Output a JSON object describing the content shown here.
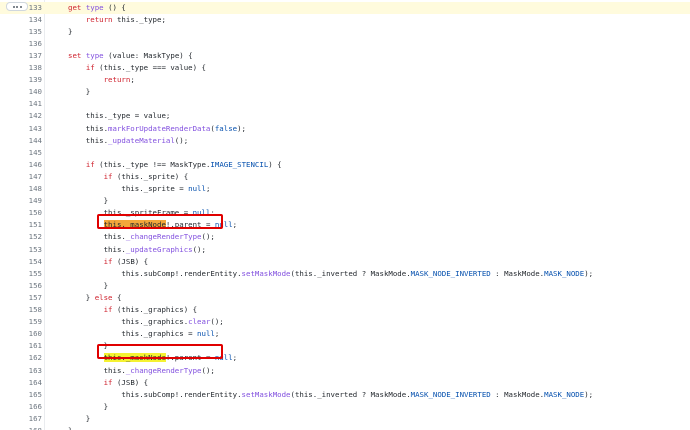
{
  "viewer": {
    "expand_label": "...",
    "lines": [
      {
        "n": "133",
        "highlight": true,
        "t": [
          {
            "c": "kw",
            "s": "get"
          },
          {
            "c": "p",
            "s": " "
          },
          {
            "c": "fn",
            "s": "type"
          },
          {
            "c": "p",
            "s": " () {"
          }
        ]
      },
      {
        "n": "134",
        "t": [
          {
            "c": "p",
            "s": "    "
          },
          {
            "c": "kw",
            "s": "return"
          },
          {
            "c": "p",
            "s": " this._type;"
          }
        ]
      },
      {
        "n": "135",
        "t": [
          {
            "c": "p",
            "s": "}"
          }
        ]
      },
      {
        "n": "136",
        "t": []
      },
      {
        "n": "137",
        "t": [
          {
            "c": "kw",
            "s": "set"
          },
          {
            "c": "p",
            "s": " "
          },
          {
            "c": "fn",
            "s": "type"
          },
          {
            "c": "p",
            "s": " (value: MaskType) {"
          }
        ]
      },
      {
        "n": "138",
        "t": [
          {
            "c": "p",
            "s": "    "
          },
          {
            "c": "kw",
            "s": "if"
          },
          {
            "c": "p",
            "s": " (this._type === value) {"
          }
        ]
      },
      {
        "n": "139",
        "t": [
          {
            "c": "p",
            "s": "        "
          },
          {
            "c": "kw",
            "s": "return"
          },
          {
            "c": "p",
            "s": ";"
          }
        ]
      },
      {
        "n": "140",
        "t": [
          {
            "c": "p",
            "s": "    }"
          }
        ]
      },
      {
        "n": "141",
        "t": []
      },
      {
        "n": "142",
        "t": [
          {
            "c": "p",
            "s": "    this._type = value;"
          }
        ]
      },
      {
        "n": "143",
        "t": [
          {
            "c": "p",
            "s": "    this."
          },
          {
            "c": "fn",
            "s": "markForUpdateRenderData"
          },
          {
            "c": "p",
            "s": "("
          },
          {
            "c": "th",
            "s": "false"
          },
          {
            "c": "p",
            "s": ");"
          }
        ]
      },
      {
        "n": "144",
        "t": [
          {
            "c": "p",
            "s": "    this."
          },
          {
            "c": "fn",
            "s": "_updateMaterial"
          },
          {
            "c": "p",
            "s": "();"
          }
        ]
      },
      {
        "n": "145",
        "t": []
      },
      {
        "n": "146",
        "t": [
          {
            "c": "p",
            "s": "    "
          },
          {
            "c": "kw",
            "s": "if"
          },
          {
            "c": "p",
            "s": " (this._type !== MaskType."
          },
          {
            "c": "th",
            "s": "IMAGE_STENCIL"
          },
          {
            "c": "p",
            "s": ") {"
          }
        ]
      },
      {
        "n": "147",
        "t": [
          {
            "c": "p",
            "s": "        "
          },
          {
            "c": "kw",
            "s": "if"
          },
          {
            "c": "p",
            "s": " (this._sprite) {"
          }
        ]
      },
      {
        "n": "148",
        "t": [
          {
            "c": "p",
            "s": "            this._sprite = "
          },
          {
            "c": "th",
            "s": "null"
          },
          {
            "c": "p",
            "s": ";"
          }
        ]
      },
      {
        "n": "149",
        "t": [
          {
            "c": "p",
            "s": "        }"
          }
        ]
      },
      {
        "n": "150",
        "t": [
          {
            "c": "p",
            "s": "        this._spriteFrame = "
          },
          {
            "c": "th",
            "s": "null"
          },
          {
            "c": "p",
            "s": ";"
          }
        ]
      },
      {
        "n": "151",
        "t": [
          {
            "c": "p",
            "s": "        "
          },
          {
            "c": "hlo",
            "s": "this._maskNode"
          },
          {
            "c": "p",
            "s": "!.parent = "
          },
          {
            "c": "th",
            "s": "null"
          },
          {
            "c": "p",
            "s": ";"
          }
        ]
      },
      {
        "n": "152",
        "t": [
          {
            "c": "p",
            "s": "        this."
          },
          {
            "c": "fn",
            "s": "_changeRenderType"
          },
          {
            "c": "p",
            "s": "();"
          }
        ]
      },
      {
        "n": "153",
        "t": [
          {
            "c": "p",
            "s": "        this."
          },
          {
            "c": "fn",
            "s": "_updateGraphics"
          },
          {
            "c": "p",
            "s": "();"
          }
        ]
      },
      {
        "n": "154",
        "t": [
          {
            "c": "p",
            "s": "        "
          },
          {
            "c": "kw",
            "s": "if"
          },
          {
            "c": "p",
            "s": " (JSB) {"
          }
        ]
      },
      {
        "n": "155",
        "t": [
          {
            "c": "p",
            "s": "            this.subComp!.renderEntity."
          },
          {
            "c": "fn",
            "s": "setMaskMode"
          },
          {
            "c": "p",
            "s": "(this._inverted ? MaskMode."
          },
          {
            "c": "th",
            "s": "MASK_NODE_INVERTED"
          },
          {
            "c": "p",
            "s": " : MaskMode."
          },
          {
            "c": "th",
            "s": "MASK_NODE"
          },
          {
            "c": "p",
            "s": ");"
          }
        ]
      },
      {
        "n": "156",
        "t": [
          {
            "c": "p",
            "s": "        }"
          }
        ]
      },
      {
        "n": "157",
        "t": [
          {
            "c": "p",
            "s": "    } "
          },
          {
            "c": "kw",
            "s": "else"
          },
          {
            "c": "p",
            "s": " {"
          }
        ]
      },
      {
        "n": "158",
        "t": [
          {
            "c": "p",
            "s": "        "
          },
          {
            "c": "kw",
            "s": "if"
          },
          {
            "c": "p",
            "s": " (this._graphics) {"
          }
        ]
      },
      {
        "n": "159",
        "t": [
          {
            "c": "p",
            "s": "            this._graphics."
          },
          {
            "c": "fn",
            "s": "clear"
          },
          {
            "c": "p",
            "s": "();"
          }
        ]
      },
      {
        "n": "160",
        "t": [
          {
            "c": "p",
            "s": "            this._graphics = "
          },
          {
            "c": "th",
            "s": "null"
          },
          {
            "c": "p",
            "s": ";"
          }
        ]
      },
      {
        "n": "161",
        "t": [
          {
            "c": "p",
            "s": "        }"
          }
        ]
      },
      {
        "n": "162",
        "t": [
          {
            "c": "p",
            "s": "        "
          },
          {
            "c": "hly",
            "s": "this._maskNode"
          },
          {
            "c": "p",
            "s": "!.parent = "
          },
          {
            "c": "th",
            "s": "null"
          },
          {
            "c": "p",
            "s": ";"
          }
        ]
      },
      {
        "n": "163",
        "t": [
          {
            "c": "p",
            "s": "        this."
          },
          {
            "c": "fn",
            "s": "_changeRenderType"
          },
          {
            "c": "p",
            "s": "();"
          }
        ]
      },
      {
        "n": "164",
        "t": [
          {
            "c": "p",
            "s": "        "
          },
          {
            "c": "kw",
            "s": "if"
          },
          {
            "c": "p",
            "s": " (JSB) {"
          }
        ]
      },
      {
        "n": "165",
        "t": [
          {
            "c": "p",
            "s": "            this.subComp!.renderEntity."
          },
          {
            "c": "fn",
            "s": "setMaskMode"
          },
          {
            "c": "p",
            "s": "(this._inverted ? MaskMode."
          },
          {
            "c": "th",
            "s": "MASK_NODE_INVERTED"
          },
          {
            "c": "p",
            "s": " : MaskMode."
          },
          {
            "c": "th",
            "s": "MASK_NODE"
          },
          {
            "c": "p",
            "s": ");"
          }
        ]
      },
      {
        "n": "166",
        "t": [
          {
            "c": "p",
            "s": "        }"
          }
        ]
      },
      {
        "n": "167",
        "t": [
          {
            "c": "p",
            "s": "    }"
          }
        ]
      },
      {
        "n": "168",
        "t": [
          {
            "c": "p",
            "s": "}"
          }
        ]
      }
    ]
  },
  "colors": {
    "keyword": "#cf222e",
    "function": "#8250df",
    "constant": "#0550ae",
    "highlight_orange": "#f3a73a",
    "highlight_yellow": "#f5f232",
    "callout_border": "#e00000",
    "line_highlight": "#fffbdd"
  },
  "icons": {
    "expand": "kebab-horizontal-icon"
  }
}
